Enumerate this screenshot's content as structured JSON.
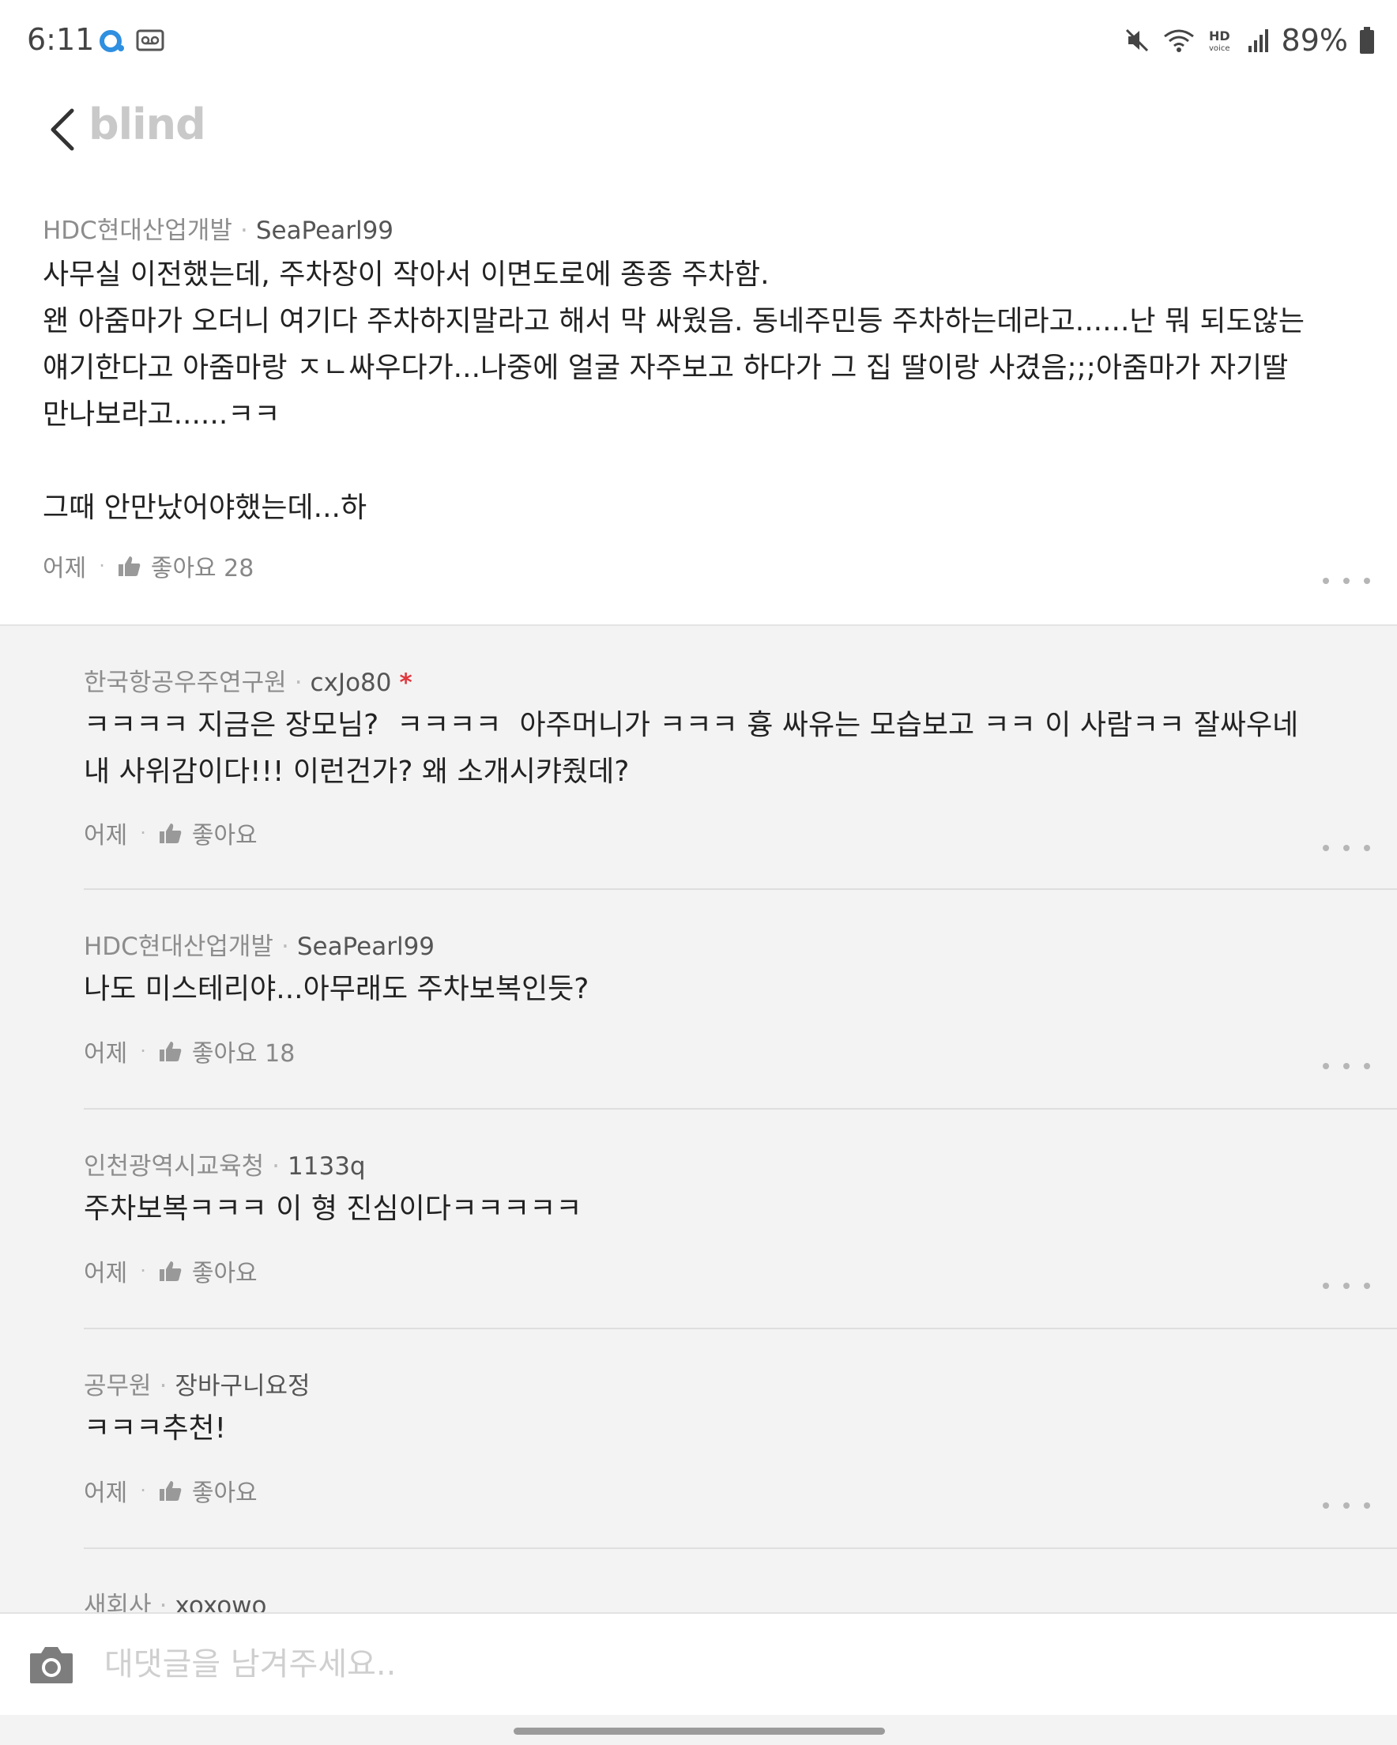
{
  "status_bar": {
    "time": "6:11",
    "battery": "89%",
    "icons": [
      "app-notification-icon",
      "voicemail-icon",
      "mute-icon",
      "wifi-icon",
      "hd-voice-icon",
      "signal-icon",
      "battery-icon"
    ]
  },
  "header": {
    "brand": "blind",
    "back_icon": "chevron-left-icon"
  },
  "main_comment": {
    "company": "HDC현대산업개발",
    "nickname": "SeaPearl99",
    "body": "사무실 이전했는데, 주차장이 작아서 이면도로에 종종 주차함.\n왠 아줌마가 오더니 여기다 주차하지말라고 해서 막 싸웠음. 동네주민등 주차하는데라고......난 뭐 되도않는\n얘기한다고 아줌마랑 ㅈㄴ싸우다가...나중에 얼굴 자주보고 하다가 그 집 딸이랑 사겼음;;;아줌마가 자기딸\n만나보라고......ㅋㅋ\n\n그때 안만났어야했는데...하",
    "time": "어제",
    "like_label": "좋아요 28"
  },
  "replies": [
    {
      "company": "한국항공우주연구원",
      "nickname": "cxJo80",
      "flag": "*",
      "body": "ㅋㅋㅋㅋ 지금은 장모님?  ㅋㅋㅋㅋ  아주머니가 ㅋㅋㅋ 흉 싸유는 모습보고 ㅋㅋ 이 사람ㅋㅋ 잘싸우네\n내 사위감이다!!! 이런건가? 왜 소개시캬줬데?",
      "time": "어제",
      "like_label": "좋아요"
    },
    {
      "company": "HDC현대산업개발",
      "nickname": "SeaPearl99",
      "flag": "",
      "body": "나도 미스테리야...아무래도 주차보복인듯?",
      "time": "어제",
      "like_label": "좋아요 18"
    },
    {
      "company": "인천광역시교육청",
      "nickname": "1133q",
      "flag": "",
      "body": "주차보복ㅋㅋㅋ 이 형 진심이다ㅋㅋㅋㅋㅋ",
      "time": "어제",
      "like_label": "좋아요"
    },
    {
      "company": "공무원",
      "nickname": "장바구니요정",
      "flag": "",
      "body": "ㅋㅋㅋ추천!",
      "time": "어제",
      "like_label": "좋아요"
    },
    {
      "company": "새회사",
      "nickname": "xoxowo",
      "flag": "",
      "body": "",
      "time": "",
      "like_label": ""
    }
  ],
  "comment_input": {
    "placeholder": "대댓글을 남겨주세요.."
  },
  "colors": {
    "reply_background": "#f3f3f3",
    "flag_red": "#e0383e",
    "brand_gray": "#c9c9c9"
  }
}
